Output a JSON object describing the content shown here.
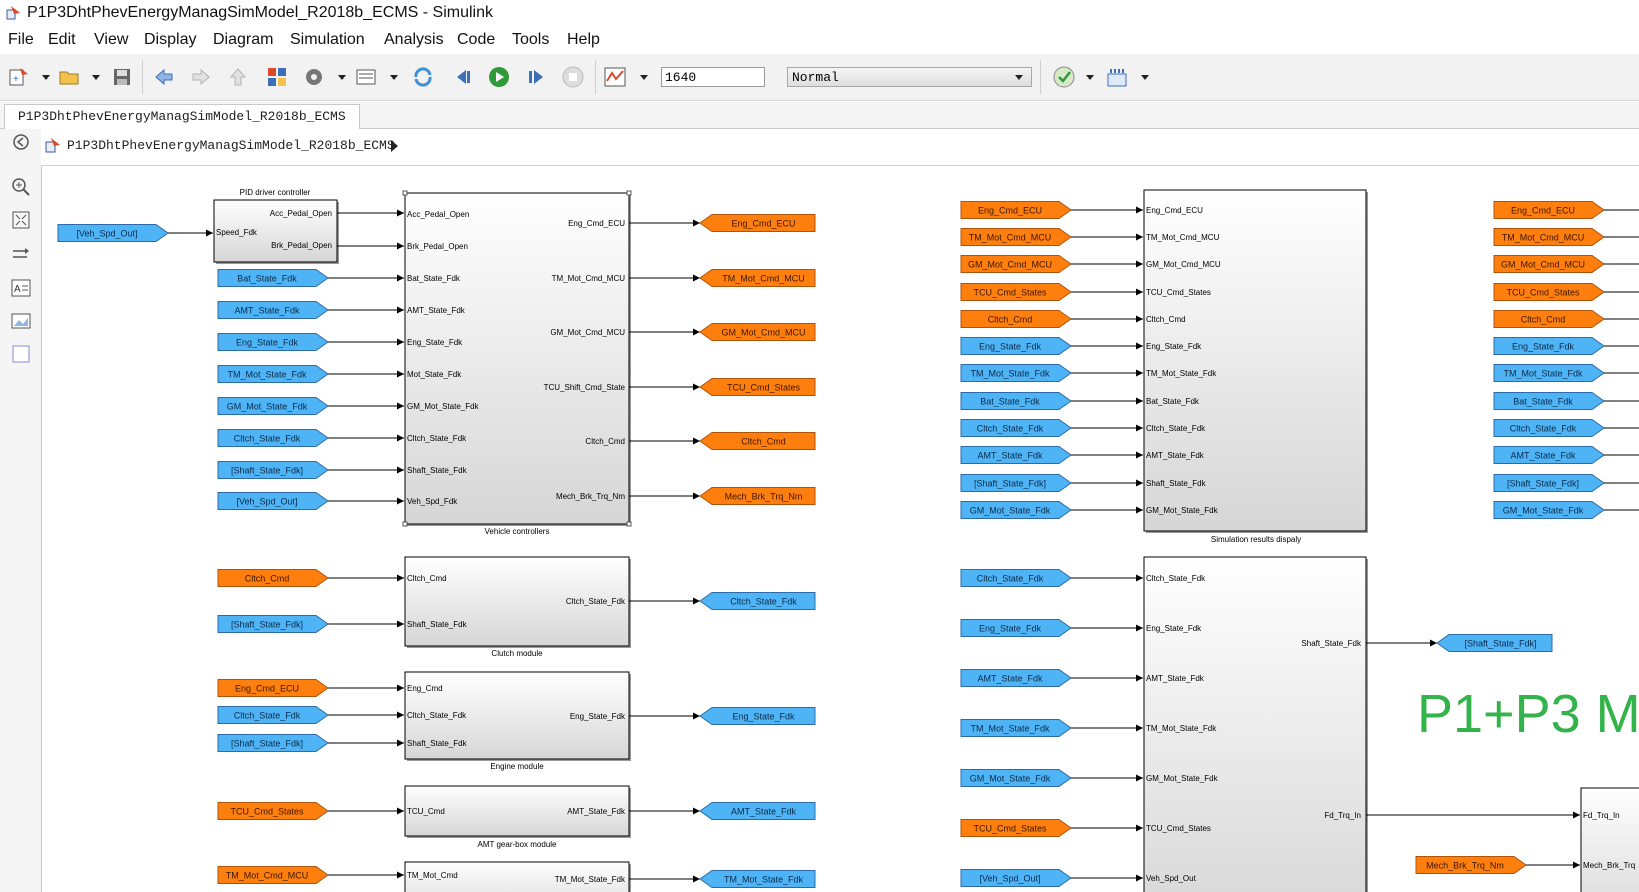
{
  "window": {
    "title": "P1P3DhtPhevEnergyManagSimModel_R2018b_ECMS - Simulink"
  },
  "menu": [
    "File",
    "Edit",
    "View",
    "Display",
    "Diagram",
    "Simulation",
    "Analysis",
    "Code",
    "Tools",
    "Help"
  ],
  "toolbar": {
    "stop_time": "1640",
    "sim_mode": "Normal"
  },
  "tab": {
    "label": "P1P3DhtPhevEnergyManagSimModel_R2018b_ECMS"
  },
  "address": {
    "path": "P1P3DhtPhevEnergyManagSimModel_R2018b_ECMS"
  },
  "colors": {
    "goto_orange": "#ff7f0e",
    "from_blue": "#4fb4f5",
    "annotation_green": "#32b44a"
  },
  "annotation": "P1+P3 M",
  "blocks": {
    "pid": {
      "title": "PID driver controller",
      "in": [
        "Speed_Fdk"
      ],
      "out": [
        "Acc_Pedal_Open",
        "Brk_Pedal_Open"
      ]
    },
    "vehicle_controllers": {
      "label": "Vehicle controllers",
      "in": [
        "Acc_Pedal_Open",
        "Brk_Pedal_Open",
        "Bat_State_Fdk",
        "AMT_State_Fdk",
        "Eng_State_Fdk",
        "Mot_State_Fdk",
        "GM_Mot_State_Fdk",
        "Cltch_State_Fdk",
        "Shaft_State_Fdk",
        "Veh_Spd_Fdk"
      ],
      "out": [
        "Eng_Cmd_ECU",
        "TM_Mot_Cmd_MCU",
        "GM_Mot_Cmd_MCU",
        "TCU_Shift_Cmd_State",
        "Cltch_Cmd",
        "Mech_Brk_Trq_Nm"
      ]
    },
    "clutch": {
      "label": "Clutch module",
      "in": [
        "Cltch_Cmd",
        "Shaft_State_Fdk"
      ],
      "out": [
        "Cltch_State_Fdk"
      ]
    },
    "engine": {
      "label": "Engine module",
      "in": [
        "Eng_Cmd",
        "Cltch_State_Fdk",
        "Shaft_State_Fdk"
      ],
      "out": [
        "Eng_State_Fdk"
      ]
    },
    "amt": {
      "label": "AMT gear-box module",
      "in": [
        "TCU_Cmd"
      ],
      "out": [
        "AMT_State_Fdk"
      ]
    },
    "tm": {
      "in": [
        "TM_Mot_Cmd"
      ],
      "out": [
        "TM_Mot_State_Fdk"
      ]
    },
    "simres": {
      "label": "Simulation results dispaly",
      "in": [
        "Eng_Cmd_ECU",
        "TM_Mot_Cmd_MCU",
        "GM_Mot_Cmd_MCU",
        "TCU_Cmd_States",
        "Cltch_Cmd",
        "Eng_State_Fdk",
        "TM_Mot_State_Fdk",
        "Bat_State_Fdk",
        "Cltch_State_Fdk",
        "AMT_State_Fdk",
        "Shaft_State_Fdk",
        "GM_Mot_State_Fdk"
      ]
    },
    "shaft": {
      "in": [
        "Cltch_State_Fdk",
        "Eng_State_Fdk",
        "AMT_State_Fdk",
        "TM_Mot_State_Fdk",
        "GM_Mot_State_Fdk",
        "TCU_Cmd_States",
        "Veh_Spd_Out"
      ],
      "out": [
        "Shaft_State_Fdk",
        "Fd_Trq_In"
      ]
    },
    "fd": {
      "in": [
        "Fd_Trq_In",
        "Mech_Brk_Trq"
      ]
    }
  },
  "tags": {
    "pid_from": "[Veh_Spd_Out]",
    "vc_from": [
      "Bat_State_Fdk",
      "AMT_State_Fdk",
      "Eng_State_Fdk",
      "TM_Mot_State_Fdk",
      "GM_Mot_State_Fdk",
      "Cltch_State_Fdk",
      "[Shaft_State_Fdk]",
      "[Veh_Spd_Out]"
    ],
    "vc_goto": [
      "Eng_Cmd_ECU",
      "TM_Mot_Cmd_MCU",
      "GM_Mot_Cmd_MCU",
      "TCU_Cmd_States",
      "Cltch_Cmd",
      "Mech_Brk_Trq_Nm"
    ],
    "clutch_from": [
      "Cltch_Cmd",
      "[Shaft_State_Fdk]"
    ],
    "clutch_goto": "Cltch_State_Fdk",
    "engine_from": [
      "Eng_Cmd_ECU",
      "Cltch_State_Fdk",
      "[Shaft_State_Fdk]"
    ],
    "engine_goto": "Eng_State_Fdk",
    "amt_from": "TCU_Cmd_States",
    "amt_goto": "AMT_State_Fdk",
    "tm_from": "TM_Mot_Cmd_MCU",
    "tm_goto": "TM_Mot_State_Fdk",
    "simres_from": [
      "Eng_Cmd_ECU",
      "TM_Mot_Cmd_MCU",
      "GM_Mot_Cmd_MCU",
      "TCU_Cmd_States",
      "Cltch_Cmd",
      "Eng_State_Fdk",
      "TM_Mot_State_Fdk",
      "Bat_State_Fdk",
      "Cltch_State_Fdk",
      "AMT_State_Fdk",
      "[Shaft_State_Fdk]",
      "GM_Mot_State_Fdk"
    ],
    "right_from": [
      "Eng_Cmd_ECU",
      "TM_Mot_Cmd_MCU",
      "GM_Mot_Cmd_MCU",
      "TCU_Cmd_States",
      "Cltch_Cmd",
      "Eng_State_Fdk",
      "TM_Mot_State_Fdk",
      "Bat_State_Fdk",
      "Cltch_State_Fdk",
      "AMT_State_Fdk",
      "[Shaft_State_Fdk]",
      "GM_Mot_State_Fdk"
    ],
    "shaft_from": [
      "Cltch_State_Fdk",
      "Eng_State_Fdk",
      "AMT_State_Fdk",
      "TM_Mot_State_Fdk",
      "GM_Mot_State_Fdk",
      "TCU_Cmd_States",
      "[Veh_Spd_Out]"
    ],
    "shaft_goto": "[Shaft_State_Fdk]",
    "fd_from": "Mech_Brk_Trq_Nm"
  }
}
